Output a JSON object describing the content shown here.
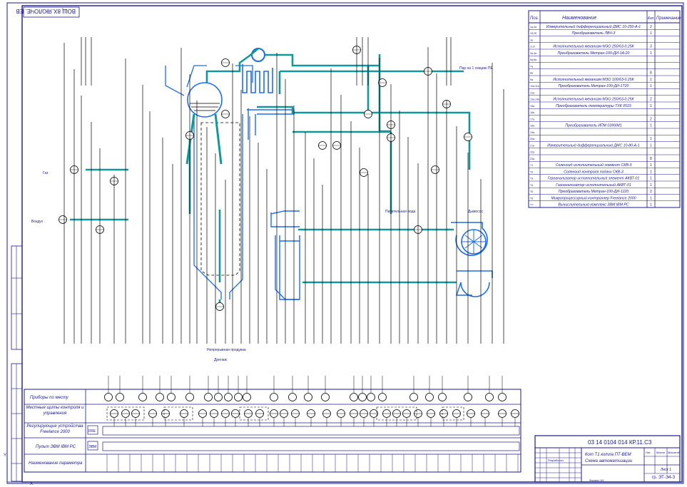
{
  "colors": {
    "frame": "#1a1a8c",
    "process_line": "#12989a",
    "equipment": "#1e6ee6",
    "signal_line": "#000000"
  },
  "stamp_rotated": "ВОЩ 8Х.ЯЮЛОЧЕ. ЕВ",
  "doc_code": "03 14 0104 014 КР.11.С3",
  "sheet_number": "Лист 1",
  "designer": "Разработал",
  "stamp_title": "Кот Т1 котла ПТ-ВЕМ",
  "stamp_subtitle": "Схема автоматизации",
  "stamp_lit": "Лит.",
  "stamp_mass": "Масса",
  "stamp_scale": "Масштаб",
  "stamp_org": "гр. ЭТ-Э4-З",
  "stamp_format": "Формат А3",
  "spec": {
    "headers": [
      "Поз.",
      "Наименование",
      "Кол.",
      "Примечание"
    ],
    "rows": [
      {
        "pos": "1а,2а",
        "name": "Измерительный дифференциальный ДМС 10-250-А-1",
        "qty": "2"
      },
      {
        "pos": "1б,2б",
        "name": "Преобразователь ЛВЧ-3",
        "qty": "1"
      },
      {
        "pos": "1в",
        "name": "",
        "qty": ""
      },
      {
        "pos": "1г,2г",
        "name": "Исполнительный механизм МЭО 250/63-0.25К",
        "qty": "3"
      },
      {
        "pos": "3а,4а",
        "name": "Преобразователь Метран-100-ДИ-1A-20",
        "qty": "1"
      },
      {
        "pos": "5а,6а",
        "name": "",
        "qty": ""
      },
      {
        "pos": "7а",
        "name": "",
        "qty": ""
      },
      {
        "pos": "8а",
        "name": "",
        "qty": "8"
      },
      {
        "pos": "9а",
        "name": "Исполнительный механизм МЭО 100/63-0.25К",
        "qty": "1"
      },
      {
        "pos": "10а,11а",
        "name": "Преобразователь Метран-100-ДИ-1T20",
        "qty": "1"
      },
      {
        "pos": "12а",
        "name": "",
        "qty": ""
      },
      {
        "pos": "13а,14а",
        "name": "Исполнительный механизм МЭО 250/63-0.25К",
        "qty": "2"
      },
      {
        "pos": "15а",
        "name": "Преобразователь температуры ТХК 0515",
        "qty": "1"
      },
      {
        "pos": "16а",
        "name": "",
        "qty": ""
      },
      {
        "pos": "17а",
        "name": "",
        "qty": "2"
      },
      {
        "pos": "18а",
        "name": "Преобразователь ИПМ 0399/М1",
        "qty": "1"
      },
      {
        "pos": "19а",
        "name": "",
        "qty": ""
      },
      {
        "pos": "20а",
        "name": "",
        "qty": "1"
      },
      {
        "pos": "21а",
        "name": "Измерительный дифференциальный ДМС 10-80-А-1",
        "qty": "1"
      },
      {
        "pos": "22а",
        "name": "",
        "qty": ""
      },
      {
        "pos": "23а",
        "name": "",
        "qty": "8"
      },
      {
        "pos": "Т1",
        "name": "Соленоид исполнительный элемент СКВ-3",
        "qty": "1"
      },
      {
        "pos": "Т2",
        "name": "Соленоид контроля подачи СКВ-3",
        "qty": "1"
      },
      {
        "pos": "Т3",
        "name": "Газоанализатор исполнительный элемент АКВТ-01",
        "qty": "1"
      },
      {
        "pos": "Т4",
        "name": "Газоанализатор исполнительный АКВТ-01",
        "qty": "1"
      },
      {
        "pos": "Т5",
        "name": "Преобразователь Метран-100-ДИ-1220",
        "qty": "2"
      },
      {
        "pos": "Т6",
        "name": "Микропроцессорный контроллер Freelance 2000",
        "qty": "1"
      },
      {
        "pos": "Т7",
        "name": "Вычислительный комплекс ЗВМ IBM PC",
        "qty": "1"
      }
    ]
  },
  "process_labels": {
    "drum_out": "Пар на 1 секцию ПЕ",
    "gas_in": "Газ",
    "air_in": "Воздух",
    "feed_water": "Питательная вода",
    "blowdown": "Непрерывная продувка",
    "fan_label": "Дымосос",
    "drain": "Дренаж"
  },
  "bottom_table": {
    "row_labels": [
      "Приборы по месту",
      "Местные щиты контроля и управления",
      "Регулирующие устройства Freelance 2000",
      "Пульт ЭВМ IBM PC",
      "Наименование параметра"
    ],
    "freelance_tag": "FRE",
    "pc_tag": "ЭВМ"
  }
}
